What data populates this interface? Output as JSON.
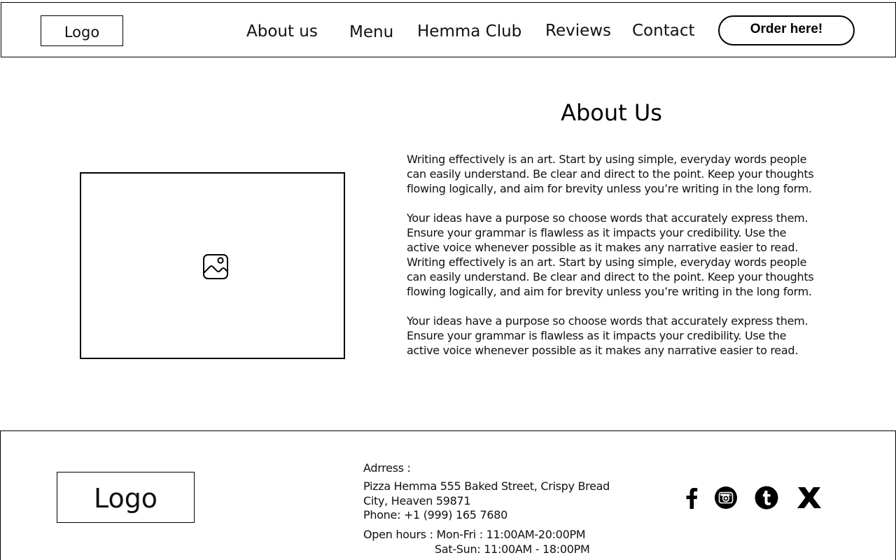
{
  "header": {
    "logo": "Logo",
    "nav": [
      "About us",
      "Menu",
      "Hemma Club",
      "Reviews",
      "Contact"
    ],
    "cta": "Order here!"
  },
  "main": {
    "image_icon": "image-icon",
    "title": "About Us",
    "paragraphs": [
      "Writing effectively is an art. Start by using simple, everyday words people can easily understand. Be clear and direct to the point. Keep your thoughts flowing logically, and aim for brevity unless you’re writing in the long form.",
      "Your ideas have a purpose so choose words that accurately express them. Ensure your grammar is flawless as it impacts your credibility. Use the active voice whenever possible as it makes any narrative easier to read.",
      "Writing effectively is an art. Start by using simple, everyday words people can easily understand. Be clear and direct to the point. Keep your thoughts flowing logically, and aim for brevity unless you’re writing in the long form.",
      "Your ideas have a purpose so choose words that accurately express them. Ensure your grammar is flawless as it impacts your credibility. Use the active voice whenever possible as it makes any narrative easier to read."
    ]
  },
  "footer": {
    "logo": "Logo",
    "address_label": "Adrress :",
    "address": "Pizza Hemma 555 Baked Street, Crispy Bread City, Heaven 59871",
    "phone": "Phone: +1 (999) 165 7680",
    "hours_weekday": "Open hours : Mon-Fri : 11:00AM-20:00PM",
    "hours_weekend": "Sat-Sun: 11:00AM - 18:00PM",
    "social_icons": [
      "facebook-icon",
      "instagram-icon",
      "tumblr-icon",
      "x-icon"
    ]
  }
}
